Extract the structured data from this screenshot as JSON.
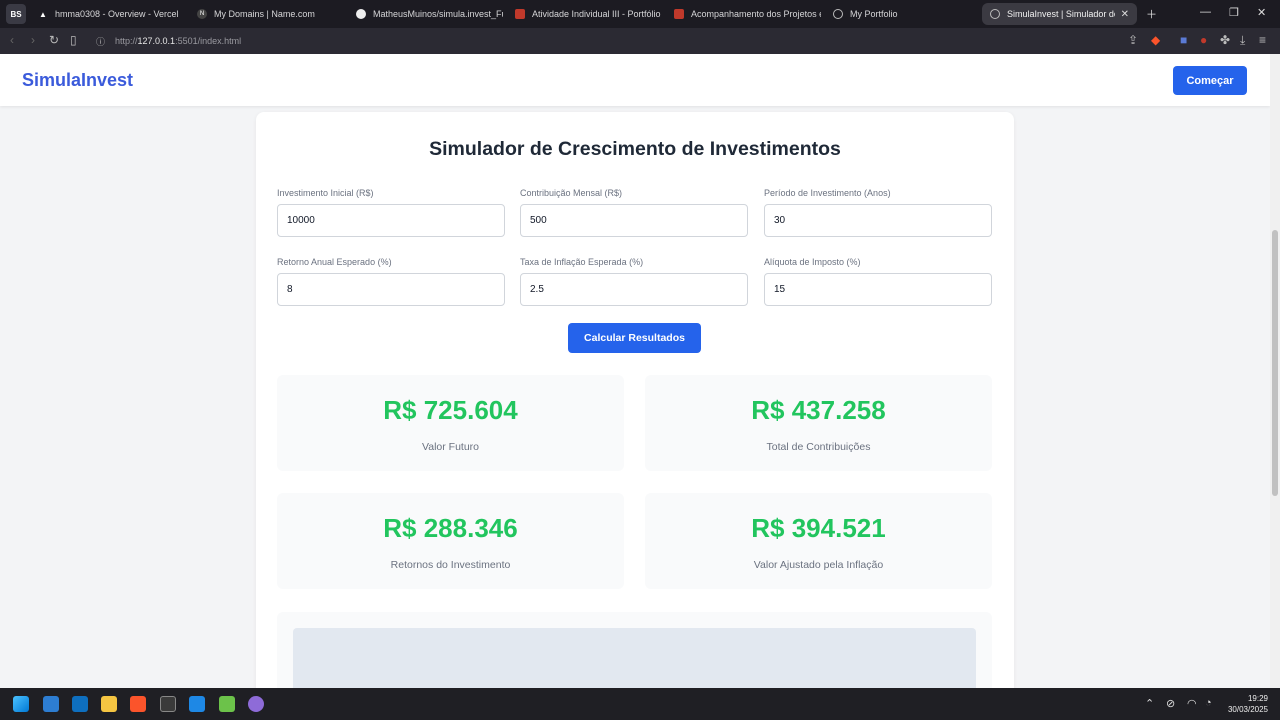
{
  "browser": {
    "profile": "BS",
    "tabs": [
      {
        "label": "hmma0308 - Overview - Vercel"
      },
      {
        "label": "My Domains | Name.com"
      },
      {
        "label": "MatheusMuinos/simula.invest_FullS"
      },
      {
        "label": "Atividade Individual III - Portfólio Pe"
      },
      {
        "label": "Acompanhamento dos Projetos em"
      },
      {
        "label": "My Portfolio"
      },
      {
        "label": "SimulaInvest | Simulador de Inv"
      }
    ],
    "url_prefix": "http://",
    "url_host": "127.0.0.1",
    "url_rest": ":5501/index.html"
  },
  "nav": {
    "logo": "SimulaInvest",
    "start_button": "Começar"
  },
  "simulator": {
    "title": "Simulador de Crescimento de Investimentos",
    "fields": [
      {
        "label": "Investimento Inicial (R$)",
        "value": "10000"
      },
      {
        "label": "Contribuição Mensal (R$)",
        "value": "500"
      },
      {
        "label": "Período de Investimento (Anos)",
        "value": "30"
      },
      {
        "label": "Retorno Anual Esperado (%)",
        "value": "8"
      },
      {
        "label": "Taxa de Inflação Esperada (%)",
        "value": "2.5"
      },
      {
        "label": "Alíquota de Imposto (%)",
        "value": "15"
      }
    ],
    "calculate_button": "Calcular Resultados",
    "results": [
      {
        "value": "R$ 725.604",
        "label": "Valor Futuro"
      },
      {
        "value": "R$ 437.258",
        "label": "Total de Contribuições"
      },
      {
        "value": "R$ 288.346",
        "label": "Retornos do Investimento"
      },
      {
        "value": "R$ 394.521",
        "label": "Valor Ajustado pela Inflação"
      }
    ]
  },
  "taskbar": {
    "time": "19:29",
    "date": "30/03/2025"
  },
  "colors": {
    "brand": "#3b5bdb",
    "primary_button": "#2563eb",
    "result_value": "#22c55e"
  }
}
